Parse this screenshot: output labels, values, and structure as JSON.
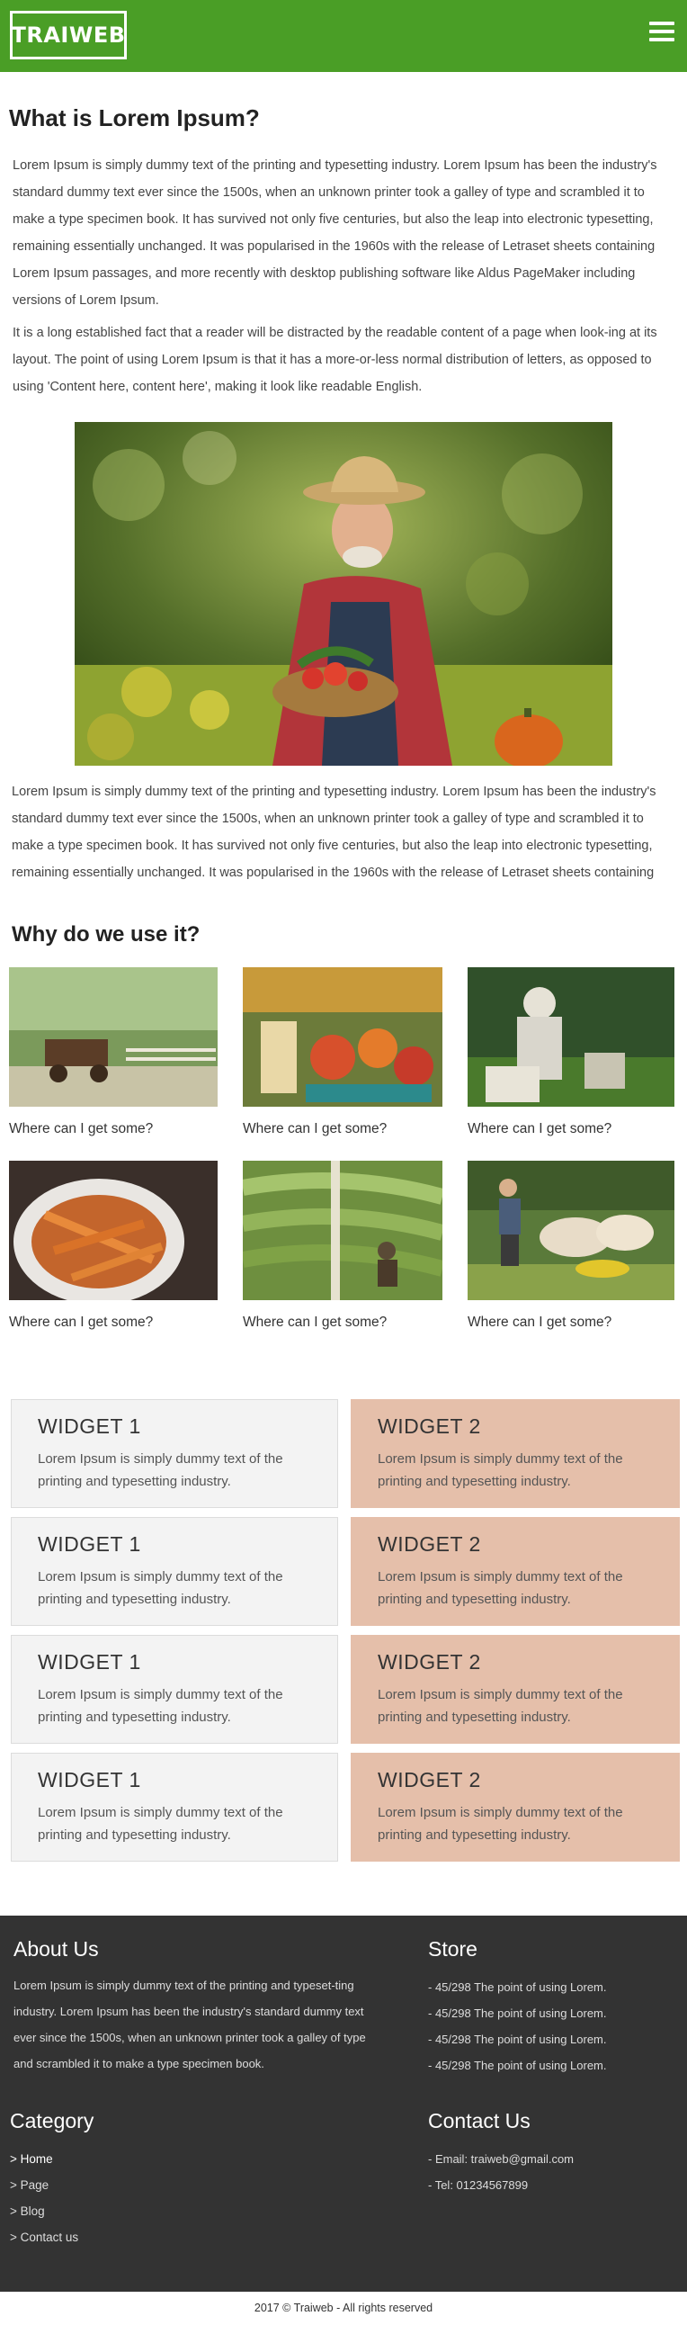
{
  "header": {
    "logo": "TRAIWEB",
    "menu_icon": "hamburger-menu-icon",
    "background_color": "#4a9e26"
  },
  "article": {
    "title": "What is Lorem Ipsum?",
    "paragraphs": [
      "Lorem Ipsum is simply dummy text of the printing and typesetting industry. Lorem Ipsum has been the industry's standard dummy text ever since the 1500s, when an unknown printer took a galley of type and scrambled it to make a type specimen book. It has survived not only five centuries, but also the leap into electronic typesetting, remaining essentially unchanged. It was popularised in the 1960s with the release of Letraset sheets containing Lorem Ipsum passages, and more recently with desktop publishing software like Aldus PageMaker including versions of Lorem Ipsum.",
      "It is a long established fact that a reader will be distracted by the readable content of a page when look-ing at its layout. The point of using Lorem Ipsum is that it has a more-or-less normal distribution of letters, as opposed to using 'Content here, content here', making it look like readable English.",
      "Lorem Ipsum is simply dummy text of the printing and typesetting industry. Lorem Ipsum has been the industry's standard dummy text ever since the 1500s, when an unknown printer took a galley of type and scrambled it to make a type specimen book. It has survived not only five centuries, but also the leap into electronic typesetting, remaining essentially unchanged. It was popularised in the 1960s with the release of Letraset sheets containing"
    ]
  },
  "why": {
    "title": "Why do we use it?",
    "items": [
      {
        "caption": "Where can I get some?"
      },
      {
        "caption": "Where can I get some?"
      },
      {
        "caption": "Where can I get some?"
      },
      {
        "caption": "Where can I get some?"
      },
      {
        "caption": "Where can I get some?"
      },
      {
        "caption": "Where can I get some?"
      }
    ]
  },
  "widgets": [
    {
      "title": "WIDGET 1",
      "text": "Lorem Ipsum is simply dummy text of the printing and typesetting industry."
    },
    {
      "title": "WIDGET 2",
      "text": "Lorem Ipsum is simply dummy text of the printing and typesetting industry."
    },
    {
      "title": "WIDGET 1",
      "text": "Lorem Ipsum is simply dummy text of the printing and typesetting industry."
    },
    {
      "title": "WIDGET 2",
      "text": "Lorem Ipsum is simply dummy text of the printing and typesetting industry."
    },
    {
      "title": "WIDGET 1",
      "text": "Lorem Ipsum is simply dummy text of the printing and typesetting industry."
    },
    {
      "title": "WIDGET 2",
      "text": "Lorem Ipsum is simply dummy text of the printing and typesetting industry."
    },
    {
      "title": "WIDGET 1",
      "text": "Lorem Ipsum is simply dummy text of the printing and typesetting industry."
    },
    {
      "title": "WIDGET 2",
      "text": "Lorem Ipsum is simply dummy text of the printing and typesetting industry."
    }
  ],
  "footer": {
    "about": {
      "title": "About Us",
      "text": "Lorem Ipsum is simply dummy text of the printing and typeset-ting industry. Lorem Ipsum has been the industry's standard dummy text ever since the 1500s, when an unknown printer took a galley of type and scrambled it to make a type specimen book."
    },
    "store": {
      "title": "Store",
      "items": [
        "- 45/298 The point of using Lorem.",
        "- 45/298 The point of using Lorem.",
        "- 45/298 The point of using Lorem.",
        "- 45/298 The point of using Lorem."
      ]
    },
    "category": {
      "title": "Category",
      "items": [
        ">  Home",
        ">  Page",
        ">  Blog",
        ">  Contact us"
      ]
    },
    "contact": {
      "title": "Contact Us",
      "items": [
        "- Email: traiweb@gmail.com",
        "- Tel: 01234567899"
      ]
    },
    "copyright": "2017 © Traiweb - All rights reserved"
  },
  "colors": {
    "brand_green": "#4a9e26",
    "widget_1_bg": "#f3f3f3",
    "widget_2_bg": "#e5bfaa",
    "footer_bg": "#333333"
  }
}
